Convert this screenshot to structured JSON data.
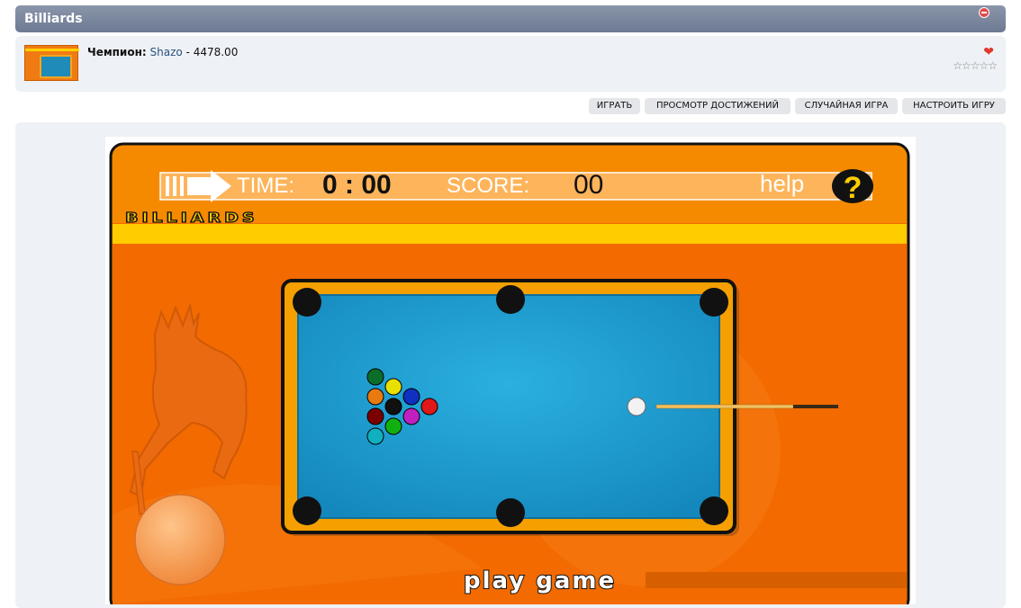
{
  "window": {
    "title": "Billiards"
  },
  "info": {
    "champion_label": "Чемпион:",
    "champion_name": "Shazo",
    "separator": " - ",
    "score": "4478.00",
    "stars": "☆☆☆☆☆"
  },
  "actions": {
    "play": "ИГРАТЬ",
    "achievements": "ПРОСМОТР ДОСТИЖЕНИЙ",
    "random": "СЛУЧАЙНАЯ ИГРА",
    "settings": "НАСТРОИТЬ ИГРУ"
  },
  "game": {
    "time_label": "TIME:",
    "time_value": "0 : 00",
    "score_label": "SCORE:",
    "score_value": "00",
    "help_label": "help",
    "help_symbol": "?",
    "logo_text": "BILLIARDS",
    "play_text": "play game",
    "colors": {
      "frame": "#f57c00",
      "background": "#f26a00",
      "stripe": "#ffcc00",
      "table_felt": "#1a9fd0",
      "table_rail": "#f5a000"
    }
  }
}
